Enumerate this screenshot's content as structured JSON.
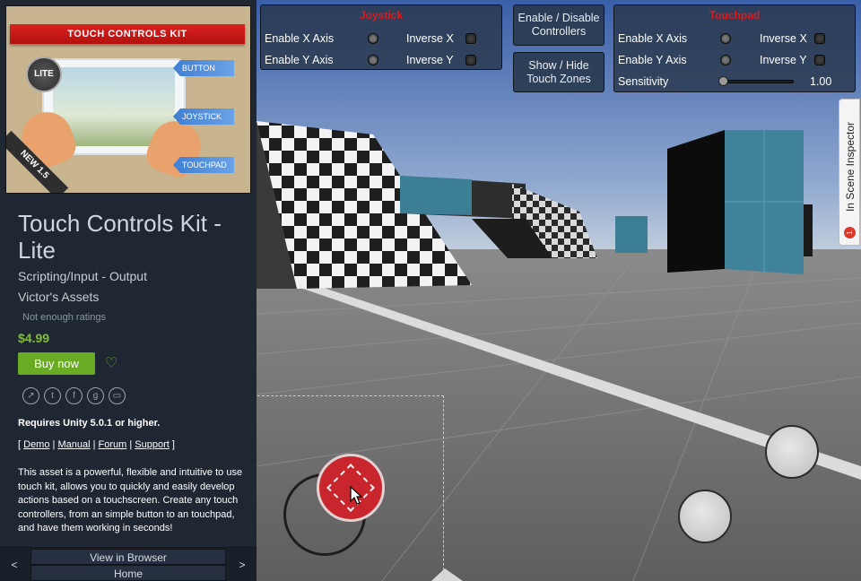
{
  "store": {
    "banner": "TOUCH CONTROLS KIT",
    "badge_lite": "LITE",
    "ribbon": "NEW 1.5",
    "tag_button": "BUTTON",
    "tag_joystick": "JOYSTICK",
    "tag_touchpad": "TOUCHPAD",
    "title": "Touch Controls Kit - Lite",
    "category": "Scripting/Input - Output",
    "publisher": "Victor's Assets",
    "ratings": "Not enough ratings",
    "price": "$4.99",
    "buy_label": "Buy now",
    "requires": "Requires Unity 5.0.1 or higher.",
    "links": [
      "Demo",
      "Manual",
      "Forum",
      "Support"
    ],
    "description": "This asset is a powerful, flexible and intuitive to use touch kit, allows you to quickly and easily develop actions based on a touchscreen. Create any touch controllers, from an simple button to an touchpad, and have them working in seconds!",
    "view_in_browser": "View in Browser",
    "home": "Home",
    "prev": "<",
    "next": ">"
  },
  "joystick_panel": {
    "title": "Joystick",
    "enable_x": "Enable X Axis",
    "enable_y": "Enable Y Axis",
    "inverse_x": "Inverse X",
    "inverse_y": "Inverse Y"
  },
  "buttons": {
    "enable_disable": "Enable / Disable Controllers",
    "show_hide": "Show / Hide Touch Zones"
  },
  "touchpad_panel": {
    "title": "Touchpad",
    "enable_x": "Enable X Axis",
    "enable_y": "Enable Y Axis",
    "inverse_x": "Inverse X",
    "inverse_y": "Inverse Y",
    "sensitivity_label": "Sensitivity",
    "sensitivity_value": "1.00"
  },
  "inspector_tab": {
    "label": "In Scene Inspector",
    "badge": "1"
  },
  "colors": {
    "panel_title": "#e21919",
    "price": "#7fc02e",
    "buy_button": "#6aab24",
    "joystick_knob": "#c8252c"
  }
}
